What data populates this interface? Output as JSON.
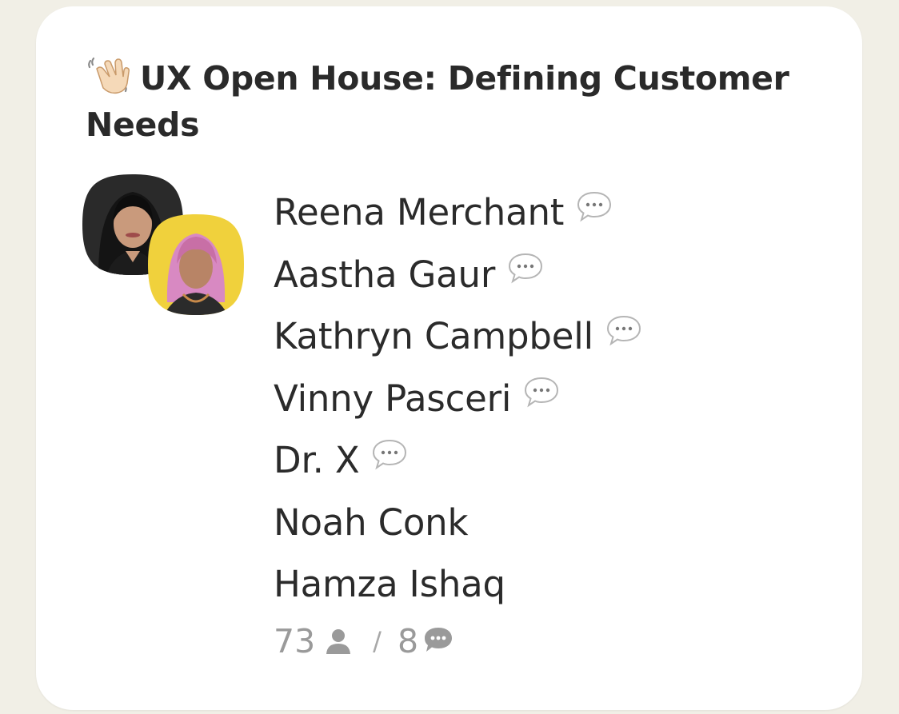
{
  "room": {
    "title": "UX Open House: Defining Customer Needs",
    "title_icon": "waving-hand-icon"
  },
  "speakers": [
    {
      "name": "Reena Merchant",
      "has_chat_icon": true
    },
    {
      "name": "Aastha Gaur",
      "has_chat_icon": true
    },
    {
      "name": "Kathryn Campbell",
      "has_chat_icon": true
    },
    {
      "name": "Vinny Pasceri",
      "has_chat_icon": true
    },
    {
      "name": "Dr. X",
      "has_chat_icon": true
    },
    {
      "name": "Noah Conk",
      "has_chat_icon": false
    },
    {
      "name": "Hamza Ishaq",
      "has_chat_icon": false
    }
  ],
  "stats": {
    "listeners": "73",
    "separator": "/",
    "speakers": "8"
  },
  "colors": {
    "background": "#f1efe6",
    "card": "#ffffff",
    "text": "#2b2b2b",
    "muted": "#9a9a9a",
    "avatar2_bg": "#f0d13c"
  }
}
